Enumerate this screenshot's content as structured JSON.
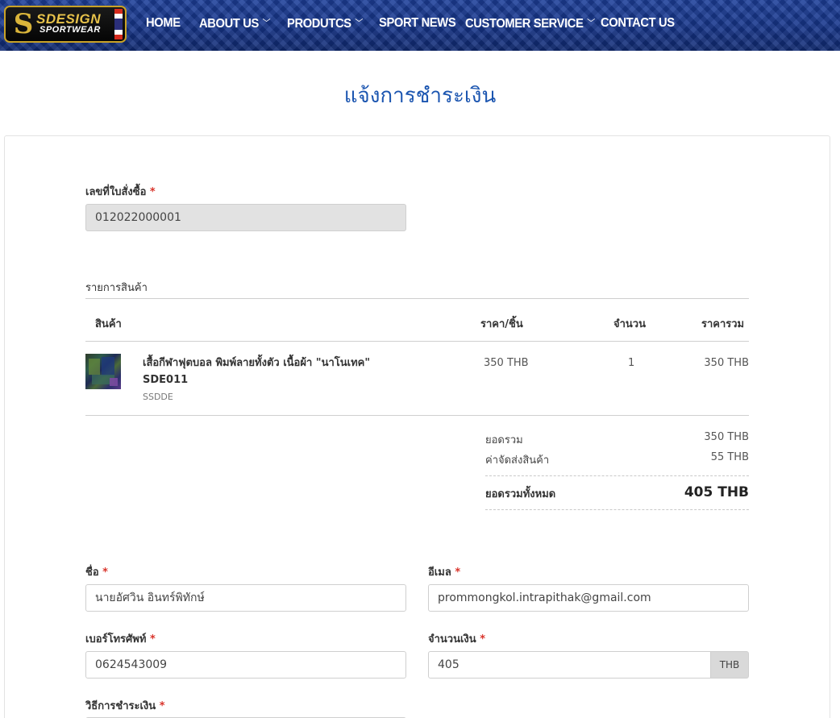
{
  "brand": {
    "logo_text_main": "SDESIGN",
    "logo_text_sub": "SPORTWEAR"
  },
  "nav": {
    "home": "HOME",
    "about": "ABOUT US",
    "products": "PRODUTCS",
    "sport_news": "SPORT NEWS",
    "customer_service": "CUSTOMER SERVICE",
    "contact": "CONTACT US"
  },
  "page": {
    "title": "แจ้งการชำระเงิน"
  },
  "order": {
    "number_label": "เลขที่ใบสั่งซื้อ",
    "number_value": "012022000001",
    "items_label": "รายการสินค้า",
    "columns": {
      "product": "สินค้า",
      "unit_price": "ราคา/ชิ้น",
      "quantity": "จำนวน",
      "total": "ราคารวม"
    },
    "items": [
      {
        "name": "เสื้อกีฬาฟุตบอล พิมพ์ลายทั้งตัว เนื้อผ้า \"นาโนเทค\" SDE011",
        "code": "SSDDE",
        "unit_price": "350 THB",
        "quantity": "1",
        "total": "350 THB"
      }
    ],
    "summary": {
      "subtotal_label": "ยอดรวม",
      "subtotal_value": "350 THB",
      "shipping_label": "ค่าจัดส่งสินค้า",
      "shipping_value": "55 THB",
      "grand_label": "ยอดรวมทั้งหมด",
      "grand_value": "405 THB"
    }
  },
  "form": {
    "required_mark": "*",
    "name_label": "ชื่อ",
    "name_value": "นายอัศวิน อินทร์พิทักษ์",
    "email_label": "อีเมล",
    "email_value": "prommongkol.intrapithak@gmail.com",
    "phone_label": "เบอร์โทรศัพท์",
    "phone_value": "0624543009",
    "amount_label": "จำนวนเงิน",
    "amount_value": "405",
    "amount_unit": "THB",
    "payment_method_label": "วิธีการชำระเงิน"
  },
  "colors": {
    "title_blue": "#1b55b0",
    "required_red": "#d9342b",
    "header_blue": "#16358a",
    "logo_gold": "#c9a227"
  }
}
